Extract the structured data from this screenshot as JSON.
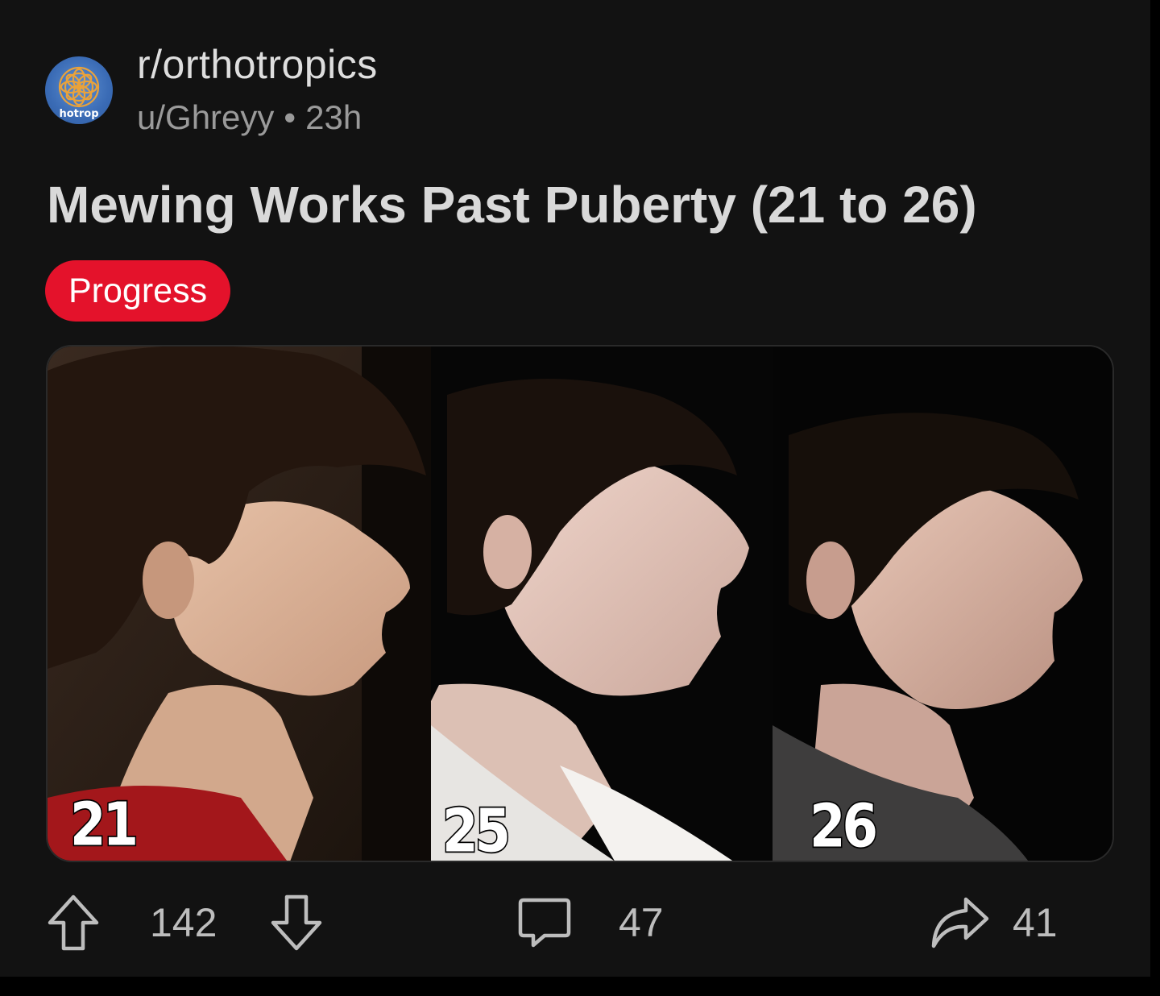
{
  "post": {
    "subreddit": "r/orthotropics",
    "author": "u/Ghreyy",
    "separator": "•",
    "age": "23h",
    "title": "Mewing Works Past Puberty (21 to 26)",
    "flair": "Progress",
    "avatar_text": "hotrop"
  },
  "media": {
    "panels": [
      {
        "label": "21"
      },
      {
        "label": "25"
      },
      {
        "label": "26"
      }
    ]
  },
  "actions": {
    "upvotes": "142",
    "comments": "47",
    "shares": "41"
  },
  "colors": {
    "background": "#121212",
    "flair": "#e4122b",
    "text_primary": "#d9d9d9",
    "text_secondary": "#9a9a9a"
  },
  "icons": {
    "upvote": "arrow-up-icon",
    "downvote": "arrow-down-icon",
    "comment": "comment-bubble-icon",
    "share": "share-arrow-icon"
  }
}
